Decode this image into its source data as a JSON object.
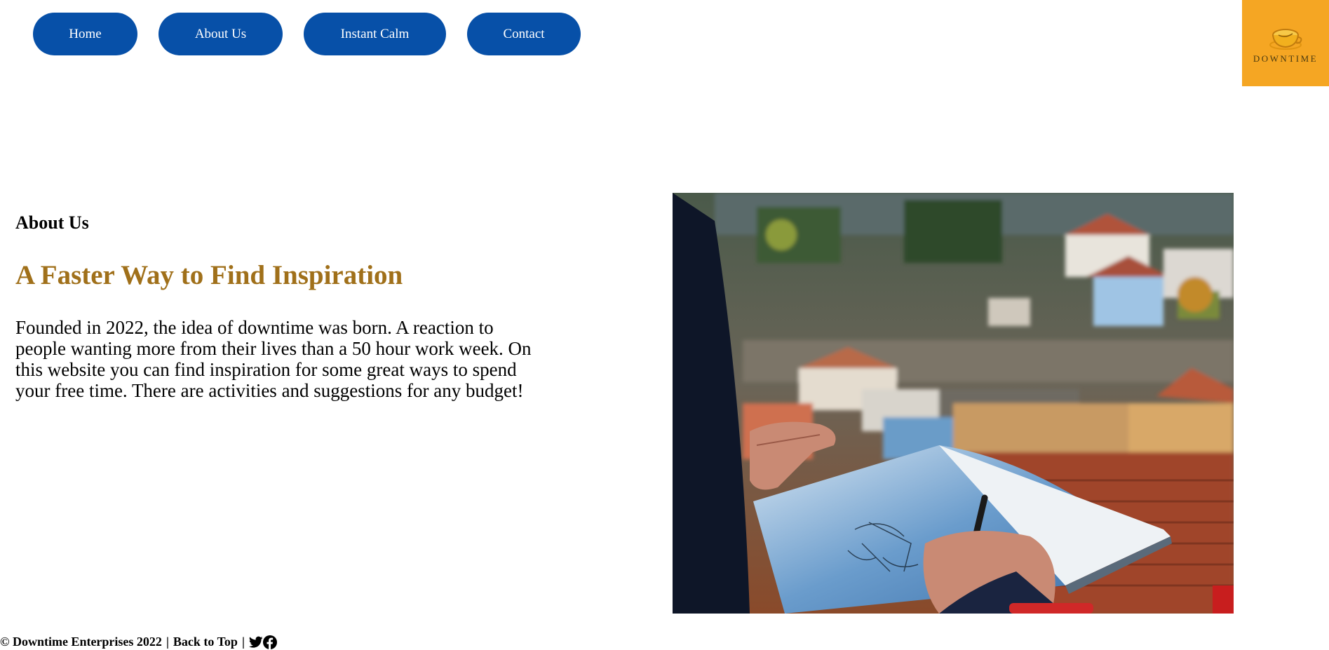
{
  "nav": {
    "items": [
      {
        "label": "Home"
      },
      {
        "label": "About Us"
      },
      {
        "label": "Instant Calm"
      },
      {
        "label": "Contact"
      }
    ]
  },
  "logo": {
    "text": "DOWNTIME",
    "icon": "coffee-cup-icon",
    "background": "#f5a623"
  },
  "main": {
    "heading": "About Us",
    "tagline": "A Faster Way to Find Inspiration",
    "body": "Founded in 2022, the idea of downtime was born. A reaction to people wanting more from their lives than a 50 hour work week. On this website you can find inspiration for some great ways to spend your free time. There are activities and suggestions for any budget!"
  },
  "photo": {
    "subject": "person-sketching-city-rooftops-image"
  },
  "footer": {
    "copyright": "© Downtime Enterprises 2022",
    "separator": "|",
    "back_to_top": "Back to Top",
    "icons": [
      "twitter-icon",
      "facebook-icon"
    ]
  },
  "colors": {
    "nav_button": "#0750a8",
    "accent": "#a0701a",
    "logo_bg": "#f5a623"
  }
}
